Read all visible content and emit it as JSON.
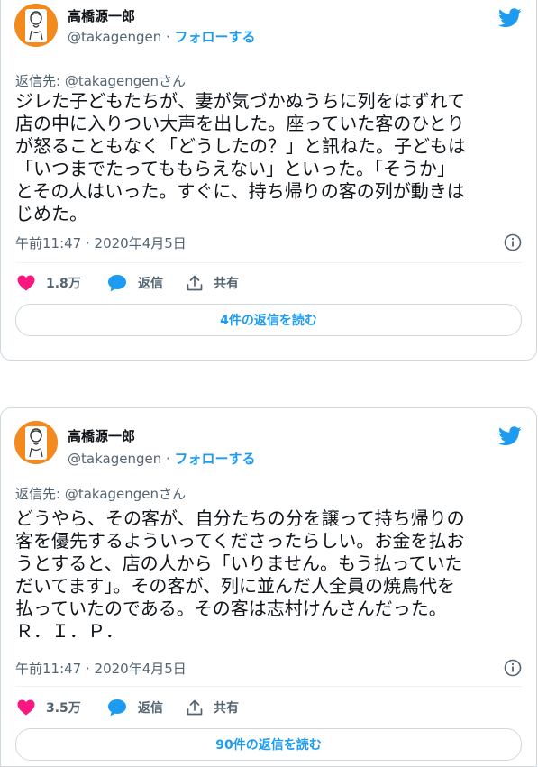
{
  "tweets": [
    {
      "author_name": "高橋源一郎",
      "handle": "@takagengen",
      "separator": " · ",
      "follow_label": "フォローする",
      "reply_to": "返信先: @takagengenさん",
      "text": "ジレた子どもたちが、妻が気づかぬうちに列をはずれて\n店の中に入りつい大声を出した。座っていた客のひとり\nが怒ることもなく「どうしたの？」と訊ねた。子どもは\n「いつまでたってももらえない」といった。「そうか」\nとその人はいった。すぐに、持ち帰りの客の列が動きは\nじめた。",
      "timestamp": "午前11:47 · 2020年4月5日",
      "likes": "1.8万",
      "reply_label": "返信",
      "share_label": "共有",
      "read_replies_label": "4件の返信を読む"
    },
    {
      "author_name": "高橋源一郎",
      "handle": "@takagengen",
      "separator": " · ",
      "follow_label": "フォローする",
      "reply_to": "返信先: @takagengenさん",
      "text": "どうやら、その客が、自分たちの分を譲って持ち帰りの\n客を優先するよういってくださったらしい。お金を払お\nうとすると、店の人から「いりません。もう払っていた\nだいてます」。その客が、列に並んだ人全員の焼鳥代を\n払っていたのである。その客は志村けんさんだった。\nＲ．Ｉ．Ｐ．",
      "timestamp": "午前11:47 · 2020年4月5日",
      "likes": "3.5万",
      "reply_label": "返信",
      "share_label": "共有",
      "read_replies_label": "90件の返信を読む"
    }
  ],
  "icons": {
    "brand": "twitter-bird-icon",
    "like": "heart-icon",
    "reply": "speech-bubble-icon",
    "share": "share-upload-icon",
    "info": "info-icon"
  },
  "colors": {
    "accent": "#1d9bf0",
    "like": "#f91880",
    "muted": "#536471",
    "text": "#0f1419",
    "avatar_bg": "#f28a1e"
  }
}
